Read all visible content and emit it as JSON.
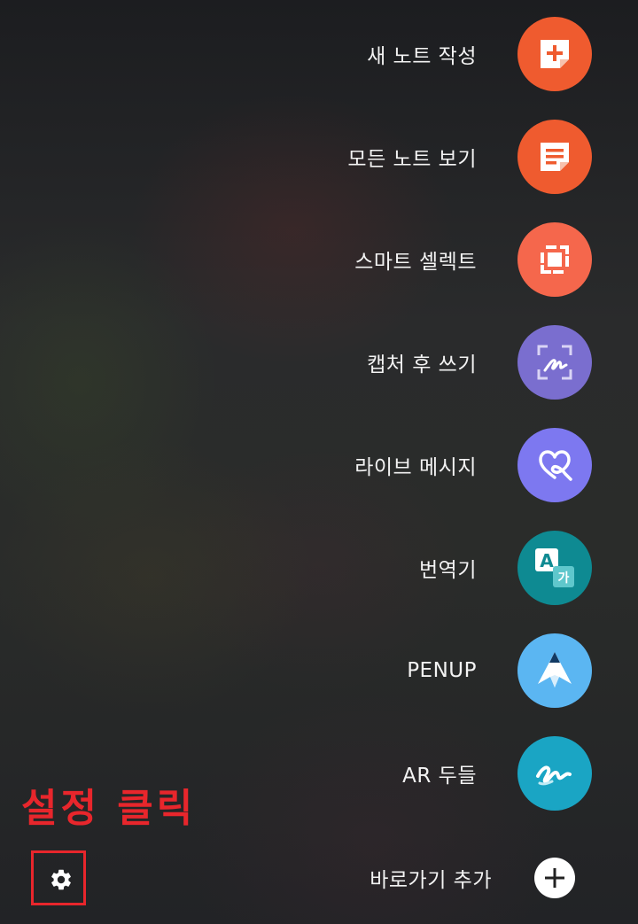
{
  "menu": {
    "items": [
      {
        "label": "새 노트 작성",
        "icon": "new-note-icon",
        "color": "#ef5b2f"
      },
      {
        "label": "모든 노트 보기",
        "icon": "all-notes-icon",
        "color": "#ef5b2f"
      },
      {
        "label": "스마트 셀렉트",
        "icon": "smart-select-icon",
        "color": "#f5674c"
      },
      {
        "label": "캡처 후 쓰기",
        "icon": "screen-write-icon",
        "color": "#7a6ecf"
      },
      {
        "label": "라이브 메시지",
        "icon": "live-message-icon",
        "color": "#7d78f0"
      },
      {
        "label": "번역기",
        "icon": "translate-icon",
        "color": "#0e8a92"
      },
      {
        "label": "PENUP",
        "icon": "penup-icon",
        "color": "#5bb6f2"
      },
      {
        "label": "AR 두들",
        "icon": "ar-doodle-icon",
        "color": "#1aa5c4"
      }
    ],
    "add_shortcut": {
      "label": "바로가기 추가",
      "icon": "plus-icon"
    }
  },
  "annotation": {
    "text": "설정 클릭",
    "color": "#e8262c"
  },
  "settings": {
    "icon": "gear-icon"
  }
}
